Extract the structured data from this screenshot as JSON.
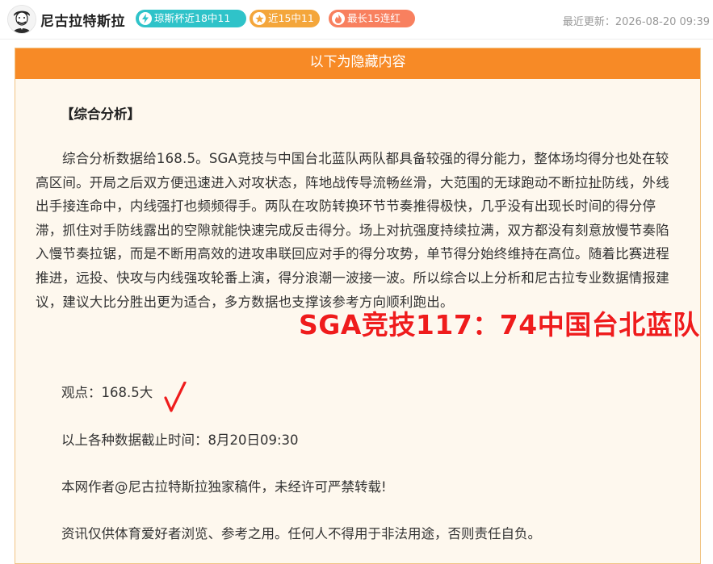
{
  "header": {
    "author_name": "尼古拉特斯拉",
    "badges": [
      {
        "label": "琼斯杯近18中11",
        "color": "#2fc3c9",
        "icon": "lightning-icon"
      },
      {
        "label": "近15中11",
        "color": "#f4a63b",
        "icon": "star-icon"
      },
      {
        "label": "最长15连红",
        "color": "#f8805f",
        "icon": "flame-icon"
      }
    ],
    "updated": "最近更新：2026-08-20 09:39"
  },
  "hidden_content": {
    "title": "以下为隐藏内容",
    "section_title": "【综合分析】",
    "analysis": "综合分析数据给168.5。SGA竞技与中国台北蓝队两队都具备较强的得分能力，整体场均得分也处在较高区间。开局之后双方便迅速进入对攻状态，阵地战传导流畅丝滑，大范围的无球跑动不断拉扯防线，外线出手接连命中，内线强打也频频得手。两队在攻防转换环节节奏推得极快，几乎没有出现长时间的得分停滞，抓住对手防线露出的空隙就能快速完成反击得分。场上对抗强度持续拉满，双方都没有刻意放慢节奏陷入慢节奏拉锯，而是不断用高效的进攻串联回应对手的得分攻势，单节得分始终维持在高位。随着比赛进程推进，远投、快攻与内线强攻轮番上演，得分浪潮一波接一波。所以综合以上分析和尼古拉专业数据情报建议，建议大比分胜出更为适合，多方数据也支撑该参考方向顺利跑出。",
    "opinion": "观点：168.5大",
    "deadline": "以上各种数据截止时间：8月20日09:30",
    "copyright": "本网作者@尼古拉特斯拉独家稿件，未经许可严禁转载!",
    "disclaimer": "资讯仅供体育爱好者浏览、参考之用。任何人不得用于非法用途，否则责任自负。"
  },
  "result_overlay": {
    "text": "SGA竞技117：74中国台北蓝队",
    "color": "#ef1c1c"
  },
  "colors": {
    "accent": "#f78a26",
    "panel_bg": "#fef8ee",
    "check_mark": "#ef1c1c"
  }
}
